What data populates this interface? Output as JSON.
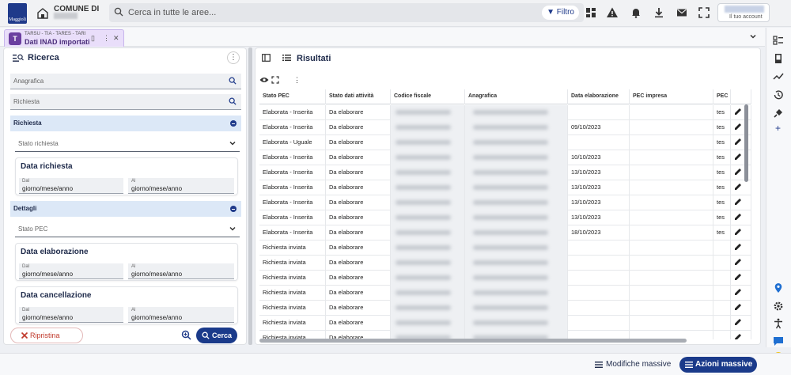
{
  "app": {
    "logo_text": "Maggioli",
    "comune_label": "COMUNE DI",
    "search_placeholder": "Cerca in tutte le aree...",
    "filter_label": "Filtro",
    "account_label": "Il tuo account"
  },
  "tab": {
    "subtitle": "TARSU - TIA - TARES - TARI",
    "title": "Dati INAD importati",
    "icon_text": "T"
  },
  "left": {
    "title": "Ricerca",
    "anagrafica_placeholder": "Anagrafica",
    "richiesta_placeholder": "Richiesta",
    "section_richiesta": "Richiesta",
    "stato_richiesta_placeholder": "Stato richiesta",
    "data_richiesta_title": "Data richiesta",
    "section_dettagli": "Dettagli",
    "stato_pec_placeholder": "Stato PEC",
    "data_elaborazione_title": "Data elaborazione",
    "data_cancellazione_title": "Data cancellazione",
    "dal_label": "Dal",
    "al_label": "Al",
    "date_placeholder": "giorno/mese/anno",
    "ripristina_label": "Ripristina",
    "cerca_label": "Cerca"
  },
  "right": {
    "title": "Risultati",
    "columns": [
      "Stato PEC",
      "Stato dati attività",
      "Codice fiscale",
      "Anagrafica",
      "Data elaborazione",
      "PEC impresa",
      "PEC"
    ],
    "rows": [
      {
        "stato_pec": "Elaborata - Inserita",
        "stato_dati": "Da elaborare",
        "data_elab": "",
        "pec": "tes"
      },
      {
        "stato_pec": "Elaborata - Inserita",
        "stato_dati": "Da elaborare",
        "data_elab": "09/10/2023",
        "pec": "tes"
      },
      {
        "stato_pec": "Elaborata - Uguale",
        "stato_dati": "Da elaborare",
        "data_elab": "",
        "pec": "tes"
      },
      {
        "stato_pec": "Elaborata - Inserita",
        "stato_dati": "Da elaborare",
        "data_elab": "10/10/2023",
        "pec": "tes"
      },
      {
        "stato_pec": "Elaborata - Inserita",
        "stato_dati": "Da elaborare",
        "data_elab": "13/10/2023",
        "pec": "tes"
      },
      {
        "stato_pec": "Elaborata - Inserita",
        "stato_dati": "Da elaborare",
        "data_elab": "13/10/2023",
        "pec": "tes"
      },
      {
        "stato_pec": "Elaborata - Inserita",
        "stato_dati": "Da elaborare",
        "data_elab": "13/10/2023",
        "pec": "tes"
      },
      {
        "stato_pec": "Elaborata - Inserita",
        "stato_dati": "Da elaborare",
        "data_elab": "13/10/2023",
        "pec": "tes"
      },
      {
        "stato_pec": "Elaborata - Inserita",
        "stato_dati": "Da elaborare",
        "data_elab": "18/10/2023",
        "pec": "tes"
      },
      {
        "stato_pec": "Richiesta inviata",
        "stato_dati": "Da elaborare",
        "data_elab": "",
        "pec": ""
      },
      {
        "stato_pec": "Richiesta inviata",
        "stato_dati": "Da elaborare",
        "data_elab": "",
        "pec": ""
      },
      {
        "stato_pec": "Richiesta inviata",
        "stato_dati": "Da elaborare",
        "data_elab": "",
        "pec": ""
      },
      {
        "stato_pec": "Richiesta inviata",
        "stato_dati": "Da elaborare",
        "data_elab": "",
        "pec": ""
      },
      {
        "stato_pec": "Richiesta inviata",
        "stato_dati": "Da elaborare",
        "data_elab": "",
        "pec": ""
      },
      {
        "stato_pec": "Richiesta inviata",
        "stato_dati": "Da elaborare",
        "data_elab": "",
        "pec": ""
      },
      {
        "stato_pec": "Richiesta inviata",
        "stato_dati": "Da elaborare",
        "data_elab": "",
        "pec": ""
      }
    ]
  },
  "bottom": {
    "modifiche_label": "Modifiche massive",
    "azioni_label": "Azioni massive"
  },
  "colors": {
    "primary": "#1a3a8a",
    "tab_bg": "#e9defa",
    "section_bg": "#dce8f7",
    "danger": "#c0392b"
  }
}
